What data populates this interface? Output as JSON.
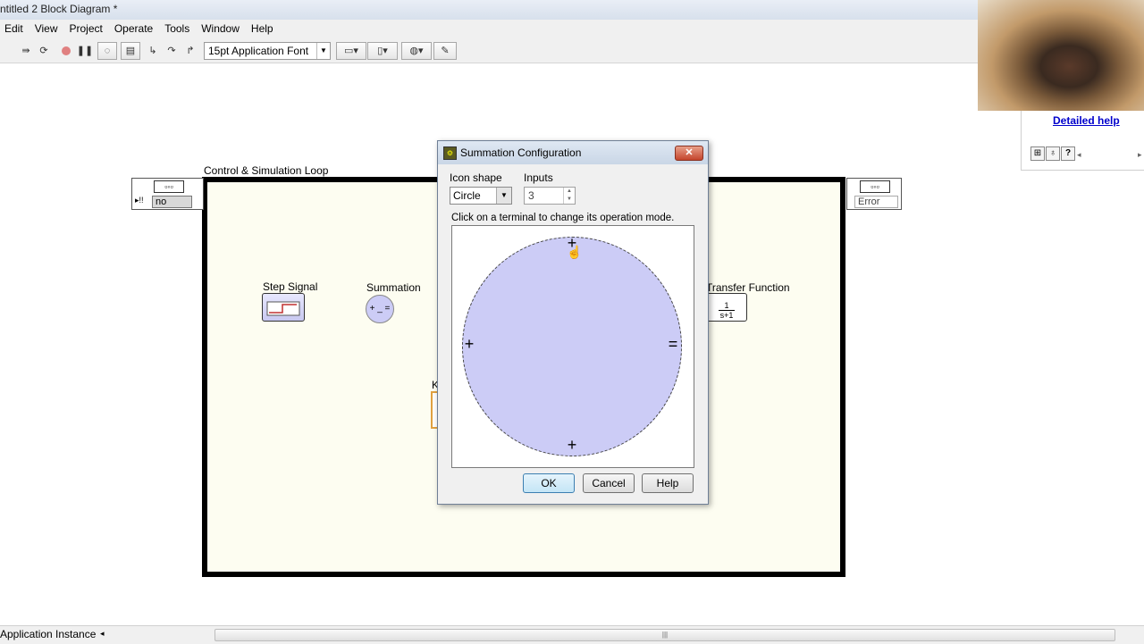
{
  "window": {
    "title": "ntitled 2 Block Diagram *"
  },
  "menu": [
    "Edit",
    "View",
    "Project",
    "Operate",
    "Tools",
    "Window",
    "Help"
  ],
  "toolbar": {
    "font": "15pt Application Font"
  },
  "help_panel": {
    "link": "Detailed help"
  },
  "diagram": {
    "loop_label": "Control & Simulation Loop",
    "left_terminal_value": "no",
    "right_terminal_value": "Error",
    "step_signal_label": "Step Signal",
    "summation_label": "Summation",
    "summation_icon_text": "+ _ =",
    "transfer_function_label": "Transfer Function",
    "tf_numerator": "1",
    "tf_denominator": "s+1",
    "partial_label": "K"
  },
  "dialog": {
    "title": "Summation Configuration",
    "close": "✕",
    "icon_shape_label": "Icon shape",
    "icon_shape_value": "Circle",
    "inputs_label": "Inputs",
    "inputs_value": "3",
    "instruction": "Click on a terminal to change its operation mode.",
    "terminals": {
      "top": "+",
      "left": "+",
      "bottom": "+",
      "right": "="
    },
    "ok": "OK",
    "cancel": "Cancel",
    "help": "Help"
  },
  "status": {
    "text": "Application Instance"
  }
}
